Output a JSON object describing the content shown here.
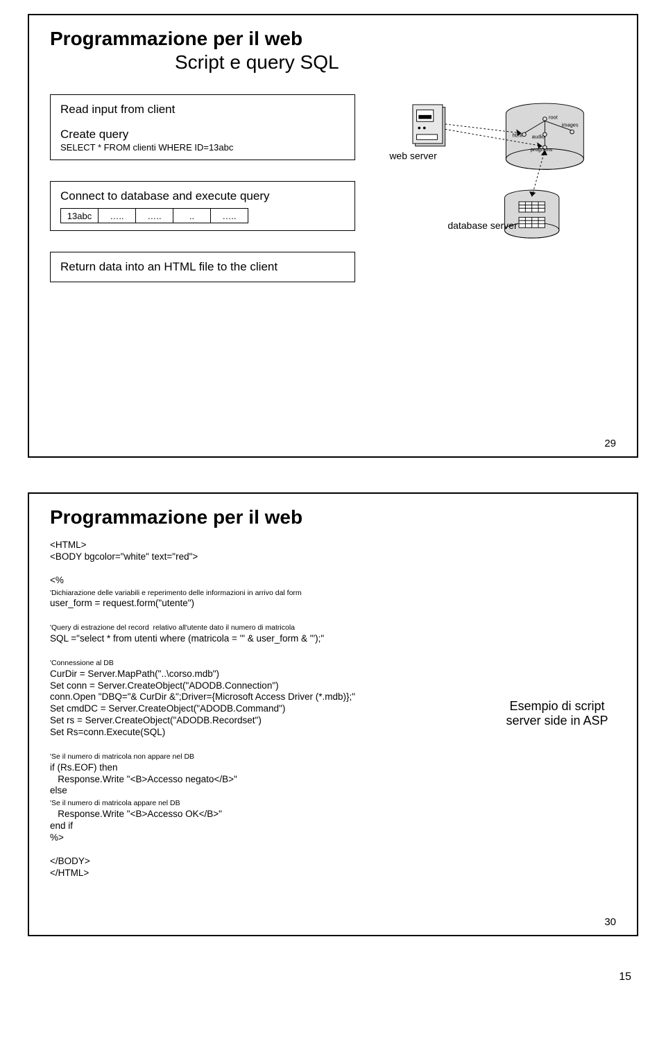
{
  "slide1": {
    "title": "Programmazione per il web",
    "subtitle": "Script e query SQL",
    "box1": {
      "line1": "Read input from client",
      "line2": "Create query",
      "line3": "SELECT * FROM clienti WHERE ID=13abc"
    },
    "box2": {
      "line1": "Connect to database and execute query",
      "cells": [
        "13abc",
        "…..",
        "…..",
        "..",
        "….."
      ]
    },
    "box3": {
      "line1": "Return data into an HTML file to the client"
    },
    "labels": {
      "webserver": "web server",
      "dbserver": "database server",
      "root": "root",
      "html": "html",
      "audio": "audio",
      "images": "images",
      "programs": "programs"
    },
    "num": "29"
  },
  "slide2": {
    "title": "Programmazione per il web",
    "code": {
      "l1": "<HTML>",
      "l2": "<BODY bgcolor=\"white\" text=\"red\">",
      "l3": "<%",
      "c1": "'Dichiarazione delle variabili e reperimento delle informazioni in arrivo dal form",
      "l4": "user_form = request.form(\"utente\")",
      "c2": "'Query di estrazione del record  relativo all'utente dato il numero di matricola",
      "l5": "SQL =\"select * from utenti where (matricola = '\" & user_form & \"');\"",
      "c3": "'Connessione al DB",
      "l6": "CurDir = Server.MapPath(\"..\\corso.mdb\")",
      "l7": "Set conn = Server.CreateObject(\"ADODB.Connection\")",
      "l8": "conn.Open \"DBQ=\"& CurDir &\";Driver={Microsoft Access Driver (*.mdb)};\"",
      "l9": "Set cmdDC = Server.CreateObject(\"ADODB.Command\")",
      "l10": "Set rs = Server.CreateObject(\"ADODB.Recordset\")",
      "l11": "Set Rs=conn.Execute(SQL)",
      "c4": "'Se il numero di matricola non appare nel DB",
      "l12": "if (Rs.EOF) then",
      "l13": "   Response.Write \"<B>Accesso negato</B>\"",
      "l14": "else",
      "c5": "'Se il numero di matricola appare nel DB",
      "l15": "   Response.Write \"<B>Accesso OK</B>\"",
      "l16": "end if",
      "l17": "%>",
      "l18": "</BODY>",
      "l19": "</HTML>"
    },
    "caption": "Esempio di script server side in ASP",
    "num": "30"
  },
  "page": "15"
}
